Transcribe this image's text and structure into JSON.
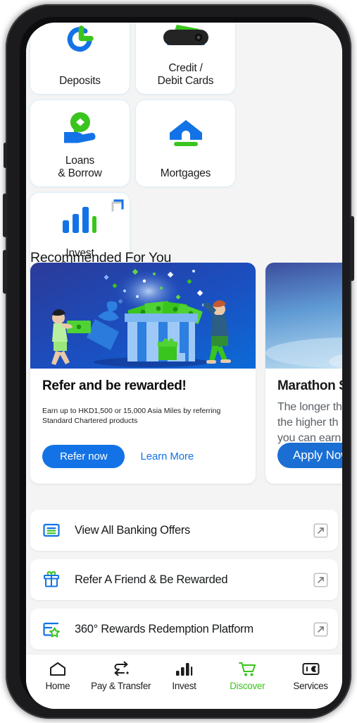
{
  "theme": {
    "brand_blue": "#1373e6",
    "brand_green": "#3ac41e",
    "page_bg": "#f4f4f4",
    "card_bg": "#ffffff",
    "active_nav_color": "#3ac41e"
  },
  "quick_tiles": [
    {
      "label": "Deposits",
      "icon": "deposits-clock-icon",
      "external_link": false
    },
    {
      "label": "Credit /\nDebit Cards",
      "icon": "wallet-card-icon",
      "external_link": false
    },
    {
      "label": "Loans\n& Borrow",
      "icon": "hand-coin-icon",
      "external_link": false
    },
    {
      "label": "Mortgages",
      "icon": "house-icon",
      "external_link": false
    },
    {
      "label": "Invest\n& Insure",
      "icon": "bar-chart-icon",
      "external_link": true
    }
  ],
  "recommended": {
    "heading": "Recommended For You",
    "cards": [
      {
        "title": "Refer and be rewarded!",
        "description": "Earn up to HKD1,500 or 15,000 Asia Miles by referring Standard Chartered products",
        "primary_label": "Refer now",
        "link_label": "Learn More",
        "hero": "gift-money-illustration"
      },
      {
        "title": "Marathon S",
        "description": "The longer th\nthe higher th\nyou can earn",
        "primary_label": "Apply Now",
        "link_label": "",
        "hero": "sky-photo"
      }
    ]
  },
  "offers": [
    {
      "label": "View All Banking Offers",
      "icon": "list-card-icon",
      "action_icon": "external-link-icon"
    },
    {
      "label": "Refer A Friend & Be Rewarded",
      "icon": "gift-box-icon",
      "action_icon": "external-link-icon"
    },
    {
      "label": "360° Rewards Redemption Platform",
      "icon": "rewards-star-icon",
      "action_icon": "external-link-icon"
    }
  ],
  "bottom_nav": {
    "items": [
      {
        "label": "Home",
        "icon": "home-icon",
        "active": false
      },
      {
        "label": "Pay & Transfer",
        "icon": "transfer-icon",
        "active": false
      },
      {
        "label": "Invest",
        "icon": "chart-icon",
        "active": false
      },
      {
        "label": "Discover",
        "icon": "cart-icon",
        "active": true
      },
      {
        "label": "Services",
        "icon": "services-icon",
        "active": false
      }
    ]
  }
}
